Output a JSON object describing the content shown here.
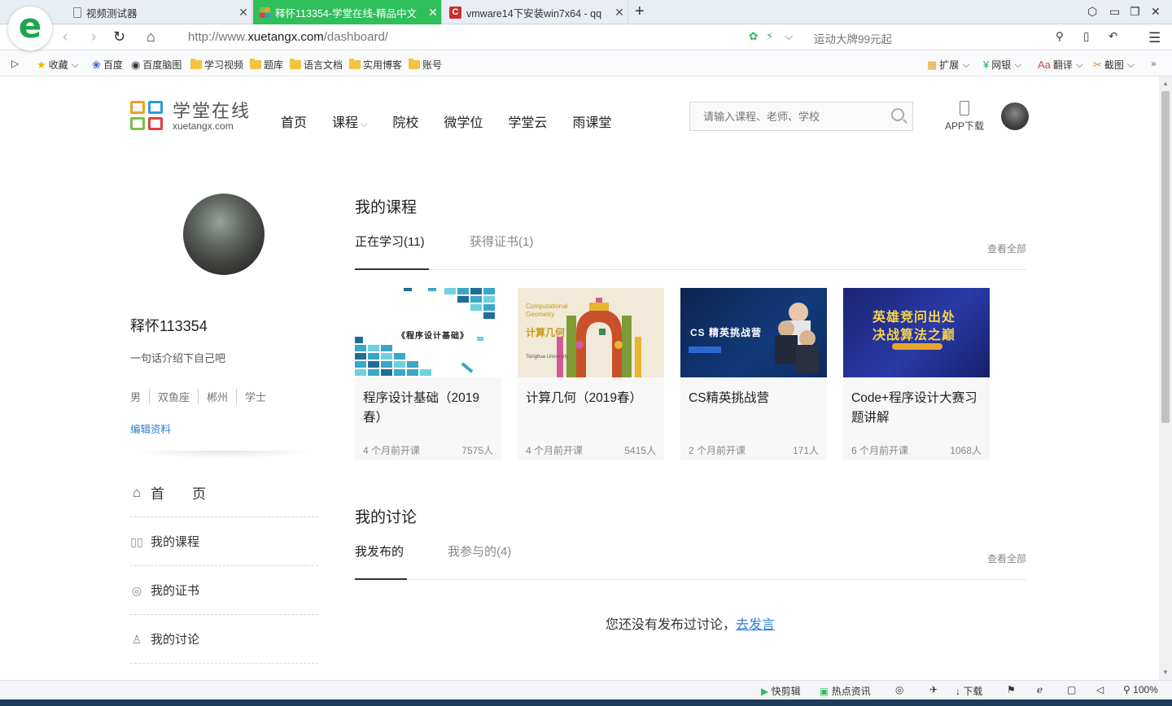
{
  "browser": {
    "logo_letter": "e",
    "tabs": [
      {
        "label": "视频测试器",
        "active": false
      },
      {
        "label": "释怀113354-学堂在线-精品中文",
        "active": true
      },
      {
        "label": "vmware14下安装win7x64 - qq",
        "active": false
      }
    ],
    "new_tab": "+",
    "url_prefix": "http://www.",
    "url_domain": "xuetangx.com",
    "url_path": "/dashboard/",
    "promo": "运动大牌99元起",
    "bookmarks": [
      {
        "label": "收藏",
        "icon": "star-icon"
      },
      {
        "label": "百度",
        "icon": "baidu-icon"
      },
      {
        "label": "百度脑图",
        "icon": "owl-icon"
      },
      {
        "label": "学习视频",
        "icon": "folder-icon"
      },
      {
        "label": "题库",
        "icon": "folder-icon"
      },
      {
        "label": "语言文档",
        "icon": "folder-icon"
      },
      {
        "label": "实用博客",
        "icon": "folder-icon"
      },
      {
        "label": "账号",
        "icon": "folder-icon"
      }
    ],
    "toolbar_right": {
      "ext": "扩展",
      "bank": "网银",
      "translate": "翻译",
      "screenshot": "截图"
    },
    "statusbar": {
      "clip": "快剪辑",
      "news": "热点资讯",
      "download": "下载",
      "zoom": "100%"
    }
  },
  "site": {
    "logo_cn": "学堂在线",
    "logo_en": "xuetangx.com",
    "nav": [
      "首页",
      "课程",
      "院校",
      "微学位",
      "学堂云",
      "雨课堂"
    ],
    "search_placeholder": "请输入课程、老师、学校",
    "app_download": "APP下载"
  },
  "profile": {
    "username": "释怀113354",
    "bio": "一句话介绍下自己吧",
    "tags": [
      "男",
      "双鱼座",
      "郴州",
      "学士"
    ],
    "edit_label": "编辑资料"
  },
  "side_menu": [
    {
      "label": "首　　页",
      "icon": "home-icon"
    },
    {
      "label": "我的课程",
      "icon": "book-icon"
    },
    {
      "label": "我的证书",
      "icon": "medal-icon"
    },
    {
      "label": "我的讨论",
      "icon": "user-icon"
    }
  ],
  "courses_section": {
    "title": "我的课程",
    "tabs": [
      "正在学习(11)",
      "获得证书(1)"
    ],
    "view_all": "查看全部",
    "cards": [
      {
        "title": "程序设计基础（2019春）",
        "time": "4 个月前开课",
        "students": "7575人",
        "cover_text": "《程序设计基础》"
      },
      {
        "title": "计算几何（2019春）",
        "time": "4 个月前开课",
        "students": "5415人",
        "cover_text": "计算几何",
        "cover_text2": "Computational Geometry",
        "cover_text3": "Tsinghua University"
      },
      {
        "title": "CS精英挑战营",
        "time": "2 个月前开课",
        "students": "171人",
        "cover_text": "CS 精英挑战营"
      },
      {
        "title": "Code+程序设计大赛习题讲解",
        "time": "6 个月前开课",
        "students": "1068人",
        "cover_text": "英雄竞问出处",
        "cover_text2": "决战算法之巅"
      }
    ]
  },
  "discussion_section": {
    "title": "我的讨论",
    "tabs": [
      "我发布的",
      "我参与的(4)"
    ],
    "view_all": "查看全部",
    "empty_text": "您还没有发布过讨论，",
    "empty_link": "去发言"
  }
}
